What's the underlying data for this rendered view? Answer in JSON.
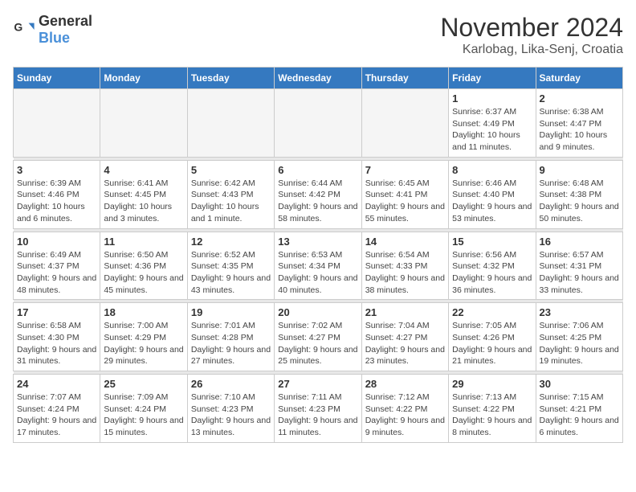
{
  "logo": {
    "text_general": "General",
    "text_blue": "Blue"
  },
  "title": {
    "month": "November 2024",
    "location": "Karlobag, Lika-Senj, Croatia"
  },
  "headers": [
    "Sunday",
    "Monday",
    "Tuesday",
    "Wednesday",
    "Thursday",
    "Friday",
    "Saturday"
  ],
  "weeks": [
    [
      {
        "day": "",
        "info": ""
      },
      {
        "day": "",
        "info": ""
      },
      {
        "day": "",
        "info": ""
      },
      {
        "day": "",
        "info": ""
      },
      {
        "day": "",
        "info": ""
      },
      {
        "day": "1",
        "info": "Sunrise: 6:37 AM\nSunset: 4:49 PM\nDaylight: 10 hours and 11 minutes."
      },
      {
        "day": "2",
        "info": "Sunrise: 6:38 AM\nSunset: 4:47 PM\nDaylight: 10 hours and 9 minutes."
      }
    ],
    [
      {
        "day": "3",
        "info": "Sunrise: 6:39 AM\nSunset: 4:46 PM\nDaylight: 10 hours and 6 minutes."
      },
      {
        "day": "4",
        "info": "Sunrise: 6:41 AM\nSunset: 4:45 PM\nDaylight: 10 hours and 3 minutes."
      },
      {
        "day": "5",
        "info": "Sunrise: 6:42 AM\nSunset: 4:43 PM\nDaylight: 10 hours and 1 minute."
      },
      {
        "day": "6",
        "info": "Sunrise: 6:44 AM\nSunset: 4:42 PM\nDaylight: 9 hours and 58 minutes."
      },
      {
        "day": "7",
        "info": "Sunrise: 6:45 AM\nSunset: 4:41 PM\nDaylight: 9 hours and 55 minutes."
      },
      {
        "day": "8",
        "info": "Sunrise: 6:46 AM\nSunset: 4:40 PM\nDaylight: 9 hours and 53 minutes."
      },
      {
        "day": "9",
        "info": "Sunrise: 6:48 AM\nSunset: 4:38 PM\nDaylight: 9 hours and 50 minutes."
      }
    ],
    [
      {
        "day": "10",
        "info": "Sunrise: 6:49 AM\nSunset: 4:37 PM\nDaylight: 9 hours and 48 minutes."
      },
      {
        "day": "11",
        "info": "Sunrise: 6:50 AM\nSunset: 4:36 PM\nDaylight: 9 hours and 45 minutes."
      },
      {
        "day": "12",
        "info": "Sunrise: 6:52 AM\nSunset: 4:35 PM\nDaylight: 9 hours and 43 minutes."
      },
      {
        "day": "13",
        "info": "Sunrise: 6:53 AM\nSunset: 4:34 PM\nDaylight: 9 hours and 40 minutes."
      },
      {
        "day": "14",
        "info": "Sunrise: 6:54 AM\nSunset: 4:33 PM\nDaylight: 9 hours and 38 minutes."
      },
      {
        "day": "15",
        "info": "Sunrise: 6:56 AM\nSunset: 4:32 PM\nDaylight: 9 hours and 36 minutes."
      },
      {
        "day": "16",
        "info": "Sunrise: 6:57 AM\nSunset: 4:31 PM\nDaylight: 9 hours and 33 minutes."
      }
    ],
    [
      {
        "day": "17",
        "info": "Sunrise: 6:58 AM\nSunset: 4:30 PM\nDaylight: 9 hours and 31 minutes."
      },
      {
        "day": "18",
        "info": "Sunrise: 7:00 AM\nSunset: 4:29 PM\nDaylight: 9 hours and 29 minutes."
      },
      {
        "day": "19",
        "info": "Sunrise: 7:01 AM\nSunset: 4:28 PM\nDaylight: 9 hours and 27 minutes."
      },
      {
        "day": "20",
        "info": "Sunrise: 7:02 AM\nSunset: 4:27 PM\nDaylight: 9 hours and 25 minutes."
      },
      {
        "day": "21",
        "info": "Sunrise: 7:04 AM\nSunset: 4:27 PM\nDaylight: 9 hours and 23 minutes."
      },
      {
        "day": "22",
        "info": "Sunrise: 7:05 AM\nSunset: 4:26 PM\nDaylight: 9 hours and 21 minutes."
      },
      {
        "day": "23",
        "info": "Sunrise: 7:06 AM\nSunset: 4:25 PM\nDaylight: 9 hours and 19 minutes."
      }
    ],
    [
      {
        "day": "24",
        "info": "Sunrise: 7:07 AM\nSunset: 4:24 PM\nDaylight: 9 hours and 17 minutes."
      },
      {
        "day": "25",
        "info": "Sunrise: 7:09 AM\nSunset: 4:24 PM\nDaylight: 9 hours and 15 minutes."
      },
      {
        "day": "26",
        "info": "Sunrise: 7:10 AM\nSunset: 4:23 PM\nDaylight: 9 hours and 13 minutes."
      },
      {
        "day": "27",
        "info": "Sunrise: 7:11 AM\nSunset: 4:23 PM\nDaylight: 9 hours and 11 minutes."
      },
      {
        "day": "28",
        "info": "Sunrise: 7:12 AM\nSunset: 4:22 PM\nDaylight: 9 hours and 9 minutes."
      },
      {
        "day": "29",
        "info": "Sunrise: 7:13 AM\nSunset: 4:22 PM\nDaylight: 9 hours and 8 minutes."
      },
      {
        "day": "30",
        "info": "Sunrise: 7:15 AM\nSunset: 4:21 PM\nDaylight: 9 hours and 6 minutes."
      }
    ]
  ]
}
